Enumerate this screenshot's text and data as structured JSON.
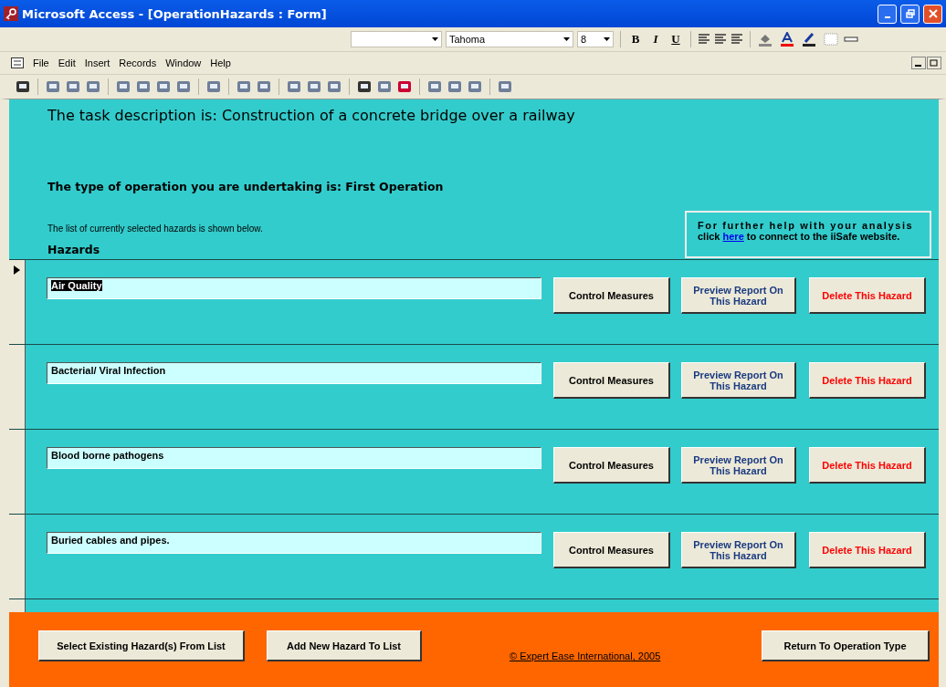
{
  "window": {
    "title": "Microsoft Access - [OperationHazards : Form]"
  },
  "formatting_toolbar": {
    "font": "Tahoma",
    "size": "8",
    "styles": [
      "B",
      "I",
      "U"
    ]
  },
  "menu": [
    "File",
    "Edit",
    "Insert",
    "Records",
    "Window",
    "Help"
  ],
  "form": {
    "task_description": "The task description is: Construction of a concrete bridge over a railway",
    "operation_type": "The type of operation you are undertaking is: First Operation",
    "list_note": "The list of currently selected hazards is shown below.",
    "help": {
      "line1": "For further help with your analysis",
      "click": "click",
      "link": "here",
      "rest": "to connect to the iiSafe website."
    },
    "hazards_heading": "Hazards",
    "hazards": [
      {
        "name": "Air Quality",
        "current": true,
        "control": "Control Measures",
        "preview": "Preview Report On This Hazard",
        "delete": "Delete This Hazard"
      },
      {
        "name": "Bacterial/ Viral Infection",
        "current": false,
        "control": "Control Measures",
        "preview": "Preview Report On This Hazard",
        "delete": "Delete This Hazard"
      },
      {
        "name": "Blood borne pathogens",
        "current": false,
        "control": "Control Measures",
        "preview": "Preview Report On This Hazard",
        "delete": "Delete This Hazard"
      },
      {
        "name": "Buried cables and pipes.",
        "current": false,
        "control": "Control Measures",
        "preview": "Preview Report On This Hazard",
        "delete": "Delete This Hazard"
      }
    ],
    "footer": {
      "select": "Select Existing Hazard(s) From List",
      "add": "Add New Hazard To List",
      "copyright": "© Expert Ease International, 2005",
      "return": "Return To Operation Type"
    }
  }
}
